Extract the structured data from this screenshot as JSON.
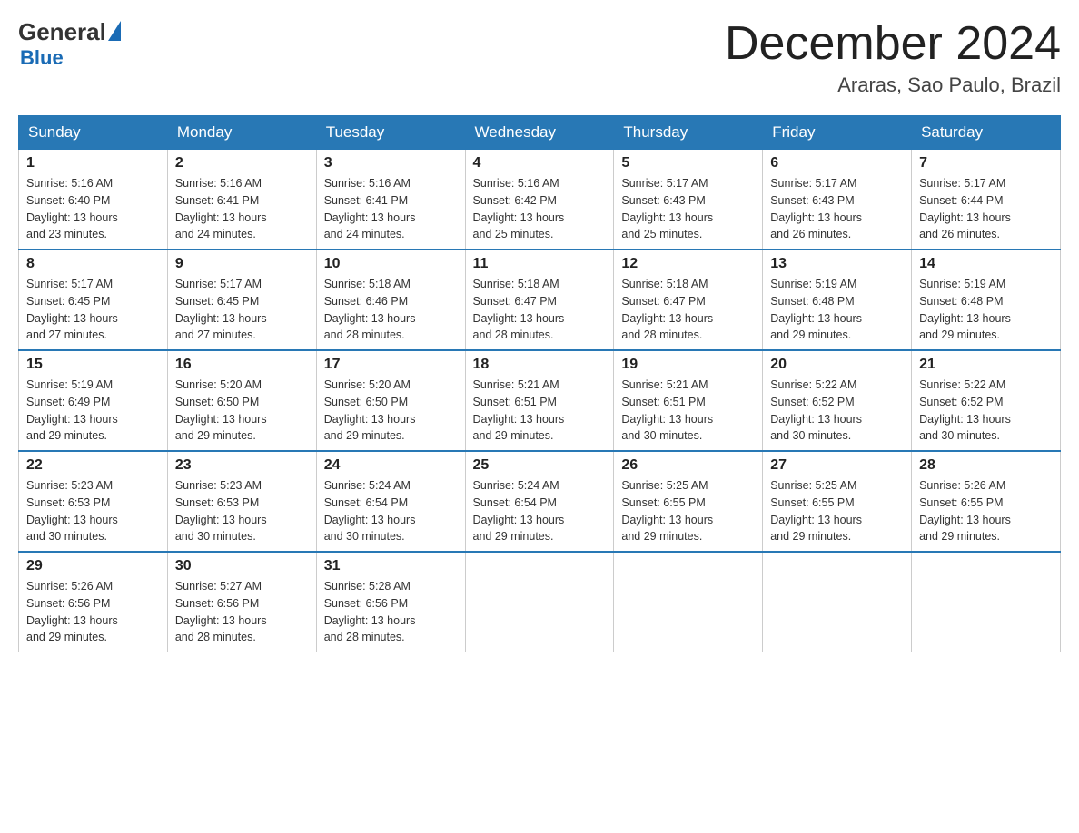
{
  "header": {
    "logo_general": "General",
    "logo_blue": "Blue",
    "title": "December 2024",
    "location": "Araras, Sao Paulo, Brazil"
  },
  "days_of_week": [
    "Sunday",
    "Monday",
    "Tuesday",
    "Wednesday",
    "Thursday",
    "Friday",
    "Saturday"
  ],
  "weeks": [
    [
      {
        "day": "1",
        "sunrise": "5:16 AM",
        "sunset": "6:40 PM",
        "daylight": "13 hours and 23 minutes."
      },
      {
        "day": "2",
        "sunrise": "5:16 AM",
        "sunset": "6:41 PM",
        "daylight": "13 hours and 24 minutes."
      },
      {
        "day": "3",
        "sunrise": "5:16 AM",
        "sunset": "6:41 PM",
        "daylight": "13 hours and 24 minutes."
      },
      {
        "day": "4",
        "sunrise": "5:16 AM",
        "sunset": "6:42 PM",
        "daylight": "13 hours and 25 minutes."
      },
      {
        "day": "5",
        "sunrise": "5:17 AM",
        "sunset": "6:43 PM",
        "daylight": "13 hours and 25 minutes."
      },
      {
        "day": "6",
        "sunrise": "5:17 AM",
        "sunset": "6:43 PM",
        "daylight": "13 hours and 26 minutes."
      },
      {
        "day": "7",
        "sunrise": "5:17 AM",
        "sunset": "6:44 PM",
        "daylight": "13 hours and 26 minutes."
      }
    ],
    [
      {
        "day": "8",
        "sunrise": "5:17 AM",
        "sunset": "6:45 PM",
        "daylight": "13 hours and 27 minutes."
      },
      {
        "day": "9",
        "sunrise": "5:17 AM",
        "sunset": "6:45 PM",
        "daylight": "13 hours and 27 minutes."
      },
      {
        "day": "10",
        "sunrise": "5:18 AM",
        "sunset": "6:46 PM",
        "daylight": "13 hours and 28 minutes."
      },
      {
        "day": "11",
        "sunrise": "5:18 AM",
        "sunset": "6:47 PM",
        "daylight": "13 hours and 28 minutes."
      },
      {
        "day": "12",
        "sunrise": "5:18 AM",
        "sunset": "6:47 PM",
        "daylight": "13 hours and 28 minutes."
      },
      {
        "day": "13",
        "sunrise": "5:19 AM",
        "sunset": "6:48 PM",
        "daylight": "13 hours and 29 minutes."
      },
      {
        "day": "14",
        "sunrise": "5:19 AM",
        "sunset": "6:48 PM",
        "daylight": "13 hours and 29 minutes."
      }
    ],
    [
      {
        "day": "15",
        "sunrise": "5:19 AM",
        "sunset": "6:49 PM",
        "daylight": "13 hours and 29 minutes."
      },
      {
        "day": "16",
        "sunrise": "5:20 AM",
        "sunset": "6:50 PM",
        "daylight": "13 hours and 29 minutes."
      },
      {
        "day": "17",
        "sunrise": "5:20 AM",
        "sunset": "6:50 PM",
        "daylight": "13 hours and 29 minutes."
      },
      {
        "day": "18",
        "sunrise": "5:21 AM",
        "sunset": "6:51 PM",
        "daylight": "13 hours and 29 minutes."
      },
      {
        "day": "19",
        "sunrise": "5:21 AM",
        "sunset": "6:51 PM",
        "daylight": "13 hours and 30 minutes."
      },
      {
        "day": "20",
        "sunrise": "5:22 AM",
        "sunset": "6:52 PM",
        "daylight": "13 hours and 30 minutes."
      },
      {
        "day": "21",
        "sunrise": "5:22 AM",
        "sunset": "6:52 PM",
        "daylight": "13 hours and 30 minutes."
      }
    ],
    [
      {
        "day": "22",
        "sunrise": "5:23 AM",
        "sunset": "6:53 PM",
        "daylight": "13 hours and 30 minutes."
      },
      {
        "day": "23",
        "sunrise": "5:23 AM",
        "sunset": "6:53 PM",
        "daylight": "13 hours and 30 minutes."
      },
      {
        "day": "24",
        "sunrise": "5:24 AM",
        "sunset": "6:54 PM",
        "daylight": "13 hours and 30 minutes."
      },
      {
        "day": "25",
        "sunrise": "5:24 AM",
        "sunset": "6:54 PM",
        "daylight": "13 hours and 29 minutes."
      },
      {
        "day": "26",
        "sunrise": "5:25 AM",
        "sunset": "6:55 PM",
        "daylight": "13 hours and 29 minutes."
      },
      {
        "day": "27",
        "sunrise": "5:25 AM",
        "sunset": "6:55 PM",
        "daylight": "13 hours and 29 minutes."
      },
      {
        "day": "28",
        "sunrise": "5:26 AM",
        "sunset": "6:55 PM",
        "daylight": "13 hours and 29 minutes."
      }
    ],
    [
      {
        "day": "29",
        "sunrise": "5:26 AM",
        "sunset": "6:56 PM",
        "daylight": "13 hours and 29 minutes."
      },
      {
        "day": "30",
        "sunrise": "5:27 AM",
        "sunset": "6:56 PM",
        "daylight": "13 hours and 28 minutes."
      },
      {
        "day": "31",
        "sunrise": "5:28 AM",
        "sunset": "6:56 PM",
        "daylight": "13 hours and 28 minutes."
      },
      null,
      null,
      null,
      null
    ]
  ],
  "labels": {
    "sunrise": "Sunrise:",
    "sunset": "Sunset:",
    "daylight": "Daylight:"
  }
}
